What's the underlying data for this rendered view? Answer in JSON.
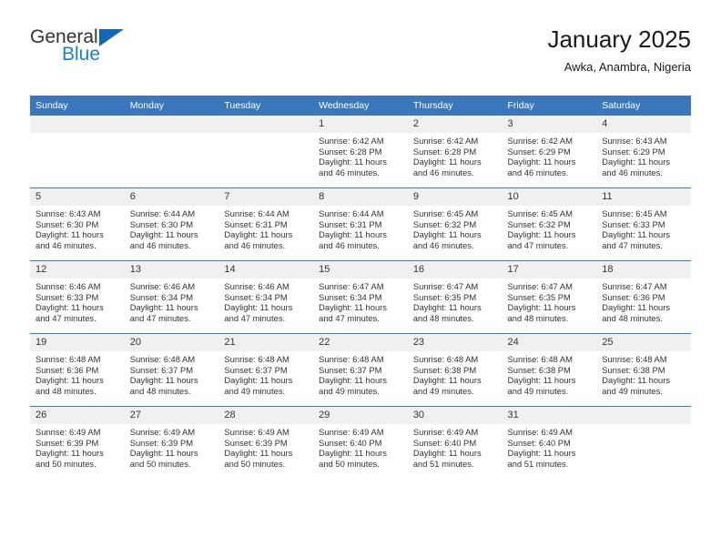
{
  "brand": {
    "name_top": "General",
    "name_bottom": "Blue",
    "triangle_color": "#1368b4",
    "blue_text_color": "#1b7fd4"
  },
  "header": {
    "title": "January 2025",
    "subtitle": "Awka, Anambra, Nigeria"
  },
  "theme": {
    "header_row_bg": "#3b77bc",
    "header_row_text": "#ffffff",
    "daynum_bg": "#f0f0f0",
    "row_divider": "#3b77bc",
    "body_text": "#333333",
    "page_bg": "#ffffff"
  },
  "calendar": {
    "weekday_headers": [
      "Sunday",
      "Monday",
      "Tuesday",
      "Wednesday",
      "Thursday",
      "Friday",
      "Saturday"
    ],
    "weeks": [
      [
        {
          "day": "",
          "blank": true,
          "sunrise": "",
          "sunset": "",
          "daylight_1": "",
          "daylight_2": ""
        },
        {
          "day": "",
          "blank": true,
          "sunrise": "",
          "sunset": "",
          "daylight_1": "",
          "daylight_2": ""
        },
        {
          "day": "",
          "blank": true,
          "sunrise": "",
          "sunset": "",
          "daylight_1": "",
          "daylight_2": ""
        },
        {
          "day": "1",
          "blank": false,
          "sunrise": "Sunrise: 6:42 AM",
          "sunset": "Sunset: 6:28 PM",
          "daylight_1": "Daylight: 11 hours",
          "daylight_2": "and 46 minutes."
        },
        {
          "day": "2",
          "blank": false,
          "sunrise": "Sunrise: 6:42 AM",
          "sunset": "Sunset: 6:28 PM",
          "daylight_1": "Daylight: 11 hours",
          "daylight_2": "and 46 minutes."
        },
        {
          "day": "3",
          "blank": false,
          "sunrise": "Sunrise: 6:42 AM",
          "sunset": "Sunset: 6:29 PM",
          "daylight_1": "Daylight: 11 hours",
          "daylight_2": "and 46 minutes."
        },
        {
          "day": "4",
          "blank": false,
          "sunrise": "Sunrise: 6:43 AM",
          "sunset": "Sunset: 6:29 PM",
          "daylight_1": "Daylight: 11 hours",
          "daylight_2": "and 46 minutes."
        }
      ],
      [
        {
          "day": "5",
          "blank": false,
          "sunrise": "Sunrise: 6:43 AM",
          "sunset": "Sunset: 6:30 PM",
          "daylight_1": "Daylight: 11 hours",
          "daylight_2": "and 46 minutes."
        },
        {
          "day": "6",
          "blank": false,
          "sunrise": "Sunrise: 6:44 AM",
          "sunset": "Sunset: 6:30 PM",
          "daylight_1": "Daylight: 11 hours",
          "daylight_2": "and 46 minutes."
        },
        {
          "day": "7",
          "blank": false,
          "sunrise": "Sunrise: 6:44 AM",
          "sunset": "Sunset: 6:31 PM",
          "daylight_1": "Daylight: 11 hours",
          "daylight_2": "and 46 minutes."
        },
        {
          "day": "8",
          "blank": false,
          "sunrise": "Sunrise: 6:44 AM",
          "sunset": "Sunset: 6:31 PM",
          "daylight_1": "Daylight: 11 hours",
          "daylight_2": "and 46 minutes."
        },
        {
          "day": "9",
          "blank": false,
          "sunrise": "Sunrise: 6:45 AM",
          "sunset": "Sunset: 6:32 PM",
          "daylight_1": "Daylight: 11 hours",
          "daylight_2": "and 46 minutes."
        },
        {
          "day": "10",
          "blank": false,
          "sunrise": "Sunrise: 6:45 AM",
          "sunset": "Sunset: 6:32 PM",
          "daylight_1": "Daylight: 11 hours",
          "daylight_2": "and 47 minutes."
        },
        {
          "day": "11",
          "blank": false,
          "sunrise": "Sunrise: 6:45 AM",
          "sunset": "Sunset: 6:33 PM",
          "daylight_1": "Daylight: 11 hours",
          "daylight_2": "and 47 minutes."
        }
      ],
      [
        {
          "day": "12",
          "blank": false,
          "sunrise": "Sunrise: 6:46 AM",
          "sunset": "Sunset: 6:33 PM",
          "daylight_1": "Daylight: 11 hours",
          "daylight_2": "and 47 minutes."
        },
        {
          "day": "13",
          "blank": false,
          "sunrise": "Sunrise: 6:46 AM",
          "sunset": "Sunset: 6:34 PM",
          "daylight_1": "Daylight: 11 hours",
          "daylight_2": "and 47 minutes."
        },
        {
          "day": "14",
          "blank": false,
          "sunrise": "Sunrise: 6:46 AM",
          "sunset": "Sunset: 6:34 PM",
          "daylight_1": "Daylight: 11 hours",
          "daylight_2": "and 47 minutes."
        },
        {
          "day": "15",
          "blank": false,
          "sunrise": "Sunrise: 6:47 AM",
          "sunset": "Sunset: 6:34 PM",
          "daylight_1": "Daylight: 11 hours",
          "daylight_2": "and 47 minutes."
        },
        {
          "day": "16",
          "blank": false,
          "sunrise": "Sunrise: 6:47 AM",
          "sunset": "Sunset: 6:35 PM",
          "daylight_1": "Daylight: 11 hours",
          "daylight_2": "and 48 minutes."
        },
        {
          "day": "17",
          "blank": false,
          "sunrise": "Sunrise: 6:47 AM",
          "sunset": "Sunset: 6:35 PM",
          "daylight_1": "Daylight: 11 hours",
          "daylight_2": "and 48 minutes."
        },
        {
          "day": "18",
          "blank": false,
          "sunrise": "Sunrise: 6:47 AM",
          "sunset": "Sunset: 6:36 PM",
          "daylight_1": "Daylight: 11 hours",
          "daylight_2": "and 48 minutes."
        }
      ],
      [
        {
          "day": "19",
          "blank": false,
          "sunrise": "Sunrise: 6:48 AM",
          "sunset": "Sunset: 6:36 PM",
          "daylight_1": "Daylight: 11 hours",
          "daylight_2": "and 48 minutes."
        },
        {
          "day": "20",
          "blank": false,
          "sunrise": "Sunrise: 6:48 AM",
          "sunset": "Sunset: 6:37 PM",
          "daylight_1": "Daylight: 11 hours",
          "daylight_2": "and 48 minutes."
        },
        {
          "day": "21",
          "blank": false,
          "sunrise": "Sunrise: 6:48 AM",
          "sunset": "Sunset: 6:37 PM",
          "daylight_1": "Daylight: 11 hours",
          "daylight_2": "and 49 minutes."
        },
        {
          "day": "22",
          "blank": false,
          "sunrise": "Sunrise: 6:48 AM",
          "sunset": "Sunset: 6:37 PM",
          "daylight_1": "Daylight: 11 hours",
          "daylight_2": "and 49 minutes."
        },
        {
          "day": "23",
          "blank": false,
          "sunrise": "Sunrise: 6:48 AM",
          "sunset": "Sunset: 6:38 PM",
          "daylight_1": "Daylight: 11 hours",
          "daylight_2": "and 49 minutes."
        },
        {
          "day": "24",
          "blank": false,
          "sunrise": "Sunrise: 6:48 AM",
          "sunset": "Sunset: 6:38 PM",
          "daylight_1": "Daylight: 11 hours",
          "daylight_2": "and 49 minutes."
        },
        {
          "day": "25",
          "blank": false,
          "sunrise": "Sunrise: 6:48 AM",
          "sunset": "Sunset: 6:38 PM",
          "daylight_1": "Daylight: 11 hours",
          "daylight_2": "and 49 minutes."
        }
      ],
      [
        {
          "day": "26",
          "blank": false,
          "sunrise": "Sunrise: 6:49 AM",
          "sunset": "Sunset: 6:39 PM",
          "daylight_1": "Daylight: 11 hours",
          "daylight_2": "and 50 minutes."
        },
        {
          "day": "27",
          "blank": false,
          "sunrise": "Sunrise: 6:49 AM",
          "sunset": "Sunset: 6:39 PM",
          "daylight_1": "Daylight: 11 hours",
          "daylight_2": "and 50 minutes."
        },
        {
          "day": "28",
          "blank": false,
          "sunrise": "Sunrise: 6:49 AM",
          "sunset": "Sunset: 6:39 PM",
          "daylight_1": "Daylight: 11 hours",
          "daylight_2": "and 50 minutes."
        },
        {
          "day": "29",
          "blank": false,
          "sunrise": "Sunrise: 6:49 AM",
          "sunset": "Sunset: 6:40 PM",
          "daylight_1": "Daylight: 11 hours",
          "daylight_2": "and 50 minutes."
        },
        {
          "day": "30",
          "blank": false,
          "sunrise": "Sunrise: 6:49 AM",
          "sunset": "Sunset: 6:40 PM",
          "daylight_1": "Daylight: 11 hours",
          "daylight_2": "and 51 minutes."
        },
        {
          "day": "31",
          "blank": false,
          "sunrise": "Sunrise: 6:49 AM",
          "sunset": "Sunset: 6:40 PM",
          "daylight_1": "Daylight: 11 hours",
          "daylight_2": "and 51 minutes."
        },
        {
          "day": "",
          "blank": true,
          "sunrise": "",
          "sunset": "",
          "daylight_1": "",
          "daylight_2": ""
        }
      ]
    ]
  }
}
